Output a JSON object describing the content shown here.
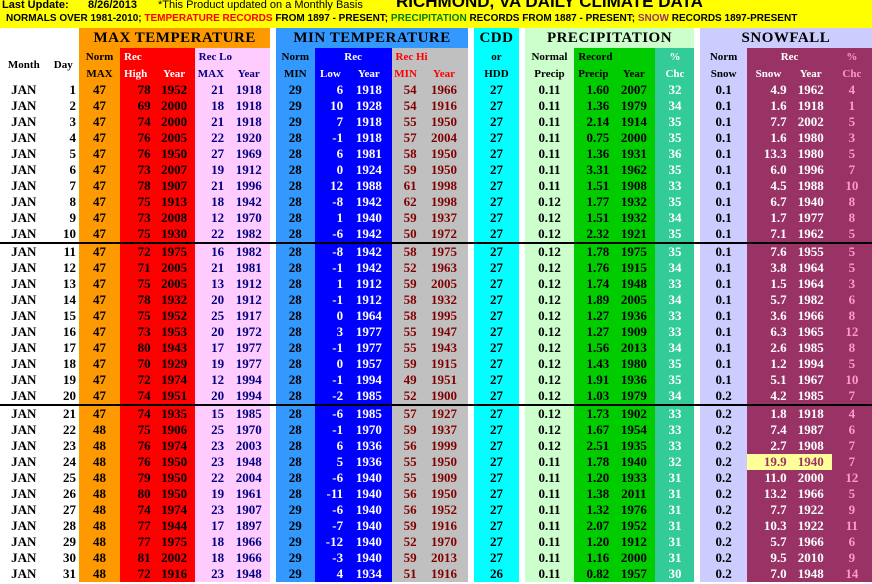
{
  "header": {
    "last_update_label": "Last Update:",
    "last_update_date": "8/26/2013",
    "note": "*This Product updated on a Monthly Basis",
    "title": "RICHMOND, VA    DAILY CLIMATE DATA",
    "normals_a": "NORMALS OVER 1981-2010;",
    "normals_b": "TEMPERATURE RECORDS",
    "normals_c": "FROM 1897 - PRESENT;",
    "normals_d": "PRECIPITATION",
    "normals_e": "RECORDS FROM 1887 - PRESENT;",
    "normals_f": "SNOW",
    "normals_g": "RECORDS 1897-PRESENT"
  },
  "columns": {
    "month": "Month",
    "day": "Day",
    "max_temp": "MAX TEMPERATURE",
    "min_temp": "MIN TEMPERATURE",
    "cdd": "CDD",
    "or": "or",
    "hdd": "HDD",
    "precip": "PRECIPITATION",
    "snowfall": "SNOWFALL",
    "norm": "Norm",
    "max": "MAX",
    "min": "MIN",
    "rec": "Rec",
    "high": "High",
    "low": "Low",
    "year": "Year",
    "rec_lo": "Rec Lo",
    "rec_hi": "Rec Hi",
    "normal": "Normal",
    "precip_short": "Precip",
    "record": "Record",
    "pct": "%",
    "chc": "Chc",
    "snow": "Snow"
  },
  "colors": {
    "header_yellow": "#ffff00",
    "max_orange": "#ff9900",
    "max_red": "#ff0000",
    "lo_pink": "#ffccff",
    "min_blue": "#0000ff",
    "hi_gray": "#c0c0c0",
    "cdd_cyan": "#00ffff",
    "precip_green": "#00cc00",
    "snow_lavender": "#ccccff",
    "snow_maroon": "#993366"
  },
  "rows": [
    [
      "JAN",
      "1",
      "47",
      "78",
      "1952",
      "21",
      "1918",
      "29",
      "6",
      "1918",
      "54",
      "1966",
      "27",
      "0.11",
      "1.60",
      "2007",
      "32",
      "0.1",
      "4.9",
      "1962",
      "4"
    ],
    [
      "JAN",
      "2",
      "47",
      "69",
      "2000",
      "18",
      "1918",
      "29",
      "10",
      "1928",
      "54",
      "1916",
      "27",
      "0.11",
      "1.36",
      "1979",
      "34",
      "0.1",
      "1.6",
      "1918",
      "1"
    ],
    [
      "JAN",
      "3",
      "47",
      "74",
      "2000",
      "21",
      "1918",
      "29",
      "7",
      "1918",
      "55",
      "1950",
      "27",
      "0.11",
      "2.14",
      "1914",
      "35",
      "0.1",
      "7.7",
      "2002",
      "5"
    ],
    [
      "JAN",
      "4",
      "47",
      "76",
      "2005",
      "22",
      "1920",
      "28",
      "-1",
      "1918",
      "57",
      "2004",
      "27",
      "0.11",
      "0.75",
      "2000",
      "35",
      "0.1",
      "1.6",
      "1980",
      "3"
    ],
    [
      "JAN",
      "5",
      "47",
      "76",
      "1950",
      "27",
      "1969",
      "28",
      "6",
      "1981",
      "58",
      "1950",
      "27",
      "0.11",
      "1.36",
      "1931",
      "36",
      "0.1",
      "13.3",
      "1980",
      "5"
    ],
    [
      "JAN",
      "6",
      "47",
      "73",
      "2007",
      "19",
      "1912",
      "28",
      "0",
      "1924",
      "59",
      "1950",
      "27",
      "0.11",
      "3.31",
      "1962",
      "35",
      "0.1",
      "6.0",
      "1996",
      "7"
    ],
    [
      "JAN",
      "7",
      "47",
      "78",
      "1907",
      "21",
      "1996",
      "28",
      "12",
      "1988",
      "61",
      "1998",
      "27",
      "0.11",
      "1.51",
      "1908",
      "33",
      "0.1",
      "4.5",
      "1988",
      "10"
    ],
    [
      "JAN",
      "8",
      "47",
      "75",
      "1913",
      "18",
      "1942",
      "28",
      "-8",
      "1942",
      "62",
      "1998",
      "27",
      "0.12",
      "1.77",
      "1932",
      "35",
      "0.1",
      "6.7",
      "1940",
      "8"
    ],
    [
      "JAN",
      "9",
      "47",
      "73",
      "2008",
      "12",
      "1970",
      "28",
      "1",
      "1940",
      "59",
      "1937",
      "27",
      "0.12",
      "1.51",
      "1932",
      "34",
      "0.1",
      "1.7",
      "1977",
      "8"
    ],
    [
      "JAN",
      "10",
      "47",
      "75",
      "1930",
      "22",
      "1982",
      "28",
      "-6",
      "1942",
      "50",
      "1972",
      "27",
      "0.12",
      "2.32",
      "1921",
      "35",
      "0.1",
      "7.1",
      "1962",
      "5"
    ],
    [
      "JAN",
      "11",
      "47",
      "72",
      "1975",
      "16",
      "1982",
      "28",
      "-8",
      "1942",
      "58",
      "1975",
      "27",
      "0.12",
      "1.78",
      "1975",
      "35",
      "0.1",
      "7.6",
      "1955",
      "5"
    ],
    [
      "JAN",
      "12",
      "47",
      "71",
      "2005",
      "21",
      "1981",
      "28",
      "-1",
      "1942",
      "52",
      "1963",
      "27",
      "0.12",
      "1.76",
      "1915",
      "34",
      "0.1",
      "3.8",
      "1964",
      "5"
    ],
    [
      "JAN",
      "13",
      "47",
      "75",
      "2005",
      "13",
      "1912",
      "28",
      "1",
      "1912",
      "59",
      "2005",
      "27",
      "0.12",
      "1.74",
      "1948",
      "33",
      "0.1",
      "1.5",
      "1964",
      "3"
    ],
    [
      "JAN",
      "14",
      "47",
      "78",
      "1932",
      "20",
      "1912",
      "28",
      "-1",
      "1912",
      "58",
      "1932",
      "27",
      "0.12",
      "1.89",
      "2005",
      "34",
      "0.1",
      "5.7",
      "1982",
      "6"
    ],
    [
      "JAN",
      "15",
      "47",
      "75",
      "1952",
      "25",
      "1917",
      "28",
      "0",
      "1964",
      "58",
      "1995",
      "27",
      "0.12",
      "1.27",
      "1936",
      "33",
      "0.1",
      "3.6",
      "1966",
      "8"
    ],
    [
      "JAN",
      "16",
      "47",
      "73",
      "1953",
      "20",
      "1972",
      "28",
      "3",
      "1977",
      "55",
      "1947",
      "27",
      "0.12",
      "1.27",
      "1909",
      "33",
      "0.1",
      "6.3",
      "1965",
      "12"
    ],
    [
      "JAN",
      "17",
      "47",
      "80",
      "1943",
      "17",
      "1977",
      "28",
      "-1",
      "1977",
      "55",
      "1943",
      "27",
      "0.12",
      "1.56",
      "2013",
      "34",
      "0.1",
      "2.6",
      "1985",
      "8"
    ],
    [
      "JAN",
      "18",
      "47",
      "70",
      "1929",
      "19",
      "1977",
      "28",
      "0",
      "1957",
      "59",
      "1915",
      "27",
      "0.12",
      "1.43",
      "1980",
      "35",
      "0.1",
      "1.2",
      "1994",
      "5"
    ],
    [
      "JAN",
      "19",
      "47",
      "72",
      "1974",
      "12",
      "1994",
      "28",
      "-1",
      "1994",
      "49",
      "1951",
      "27",
      "0.12",
      "1.91",
      "1936",
      "35",
      "0.1",
      "5.1",
      "1967",
      "10"
    ],
    [
      "JAN",
      "20",
      "47",
      "74",
      "1951",
      "20",
      "1994",
      "28",
      "-2",
      "1985",
      "52",
      "1900",
      "27",
      "0.12",
      "1.03",
      "1979",
      "34",
      "0.2",
      "4.2",
      "1985",
      "7"
    ],
    [
      "JAN",
      "21",
      "47",
      "74",
      "1935",
      "15",
      "1985",
      "28",
      "-6",
      "1985",
      "57",
      "1927",
      "27",
      "0.12",
      "1.73",
      "1902",
      "33",
      "0.2",
      "1.8",
      "1918",
      "4"
    ],
    [
      "JAN",
      "22",
      "48",
      "75",
      "1906",
      "25",
      "1970",
      "28",
      "-1",
      "1970",
      "59",
      "1937",
      "27",
      "0.12",
      "1.67",
      "1954",
      "33",
      "0.2",
      "7.4",
      "1987",
      "6"
    ],
    [
      "JAN",
      "23",
      "48",
      "76",
      "1974",
      "23",
      "2003",
      "28",
      "6",
      "1936",
      "56",
      "1999",
      "27",
      "0.12",
      "2.51",
      "1935",
      "33",
      "0.2",
      "2.7",
      "1908",
      "7"
    ],
    [
      "JAN",
      "24",
      "48",
      "76",
      "1950",
      "23",
      "1948",
      "28",
      "5",
      "1936",
      "55",
      "1950",
      "27",
      "0.11",
      "1.78",
      "1940",
      "32",
      "0.2",
      "19.9",
      "1940",
      "7"
    ],
    [
      "JAN",
      "25",
      "48",
      "79",
      "1950",
      "22",
      "2004",
      "28",
      "-6",
      "1940",
      "55",
      "1909",
      "27",
      "0.11",
      "1.20",
      "1933",
      "31",
      "0.2",
      "11.0",
      "2000",
      "12"
    ],
    [
      "JAN",
      "26",
      "48",
      "80",
      "1950",
      "19",
      "1961",
      "28",
      "-11",
      "1940",
      "56",
      "1950",
      "27",
      "0.11",
      "1.38",
      "2011",
      "31",
      "0.2",
      "13.2",
      "1966",
      "5"
    ],
    [
      "JAN",
      "27",
      "48",
      "74",
      "1974",
      "23",
      "1907",
      "29",
      "-6",
      "1940",
      "56",
      "1952",
      "27",
      "0.11",
      "1.32",
      "1976",
      "31",
      "0.2",
      "7.7",
      "1922",
      "9"
    ],
    [
      "JAN",
      "28",
      "48",
      "77",
      "1944",
      "17",
      "1897",
      "29",
      "-7",
      "1940",
      "59",
      "1916",
      "27",
      "0.11",
      "2.07",
      "1952",
      "31",
      "0.2",
      "10.3",
      "1922",
      "11"
    ],
    [
      "JAN",
      "29",
      "48",
      "77",
      "1975",
      "18",
      "1966",
      "29",
      "-12",
      "1940",
      "52",
      "1970",
      "27",
      "0.11",
      "1.20",
      "1912",
      "31",
      "0.2",
      "5.7",
      "1966",
      "6"
    ],
    [
      "JAN",
      "30",
      "48",
      "81",
      "2002",
      "18",
      "1966",
      "29",
      "-3",
      "1940",
      "59",
      "2013",
      "27",
      "0.11",
      "1.16",
      "2000",
      "31",
      "0.2",
      "9.5",
      "2010",
      "9"
    ],
    [
      "JAN",
      "31",
      "48",
      "72",
      "1916",
      "23",
      "1948",
      "29",
      "4",
      "1934",
      "51",
      "1916",
      "26",
      "0.11",
      "0.82",
      "1957",
      "30",
      "0.2",
      "7.0",
      "1948",
      "14"
    ]
  ]
}
